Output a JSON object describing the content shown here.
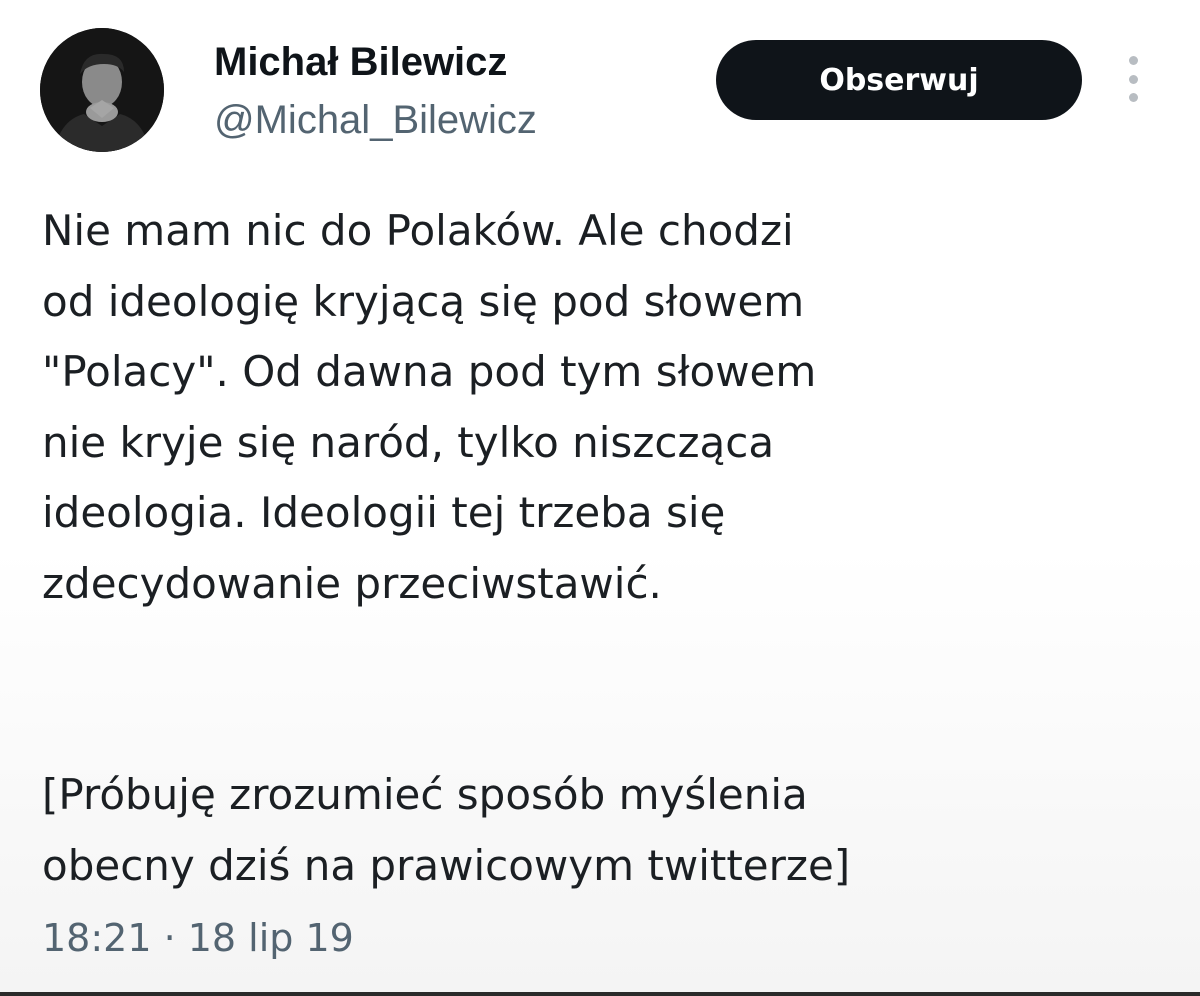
{
  "tweet": {
    "author": {
      "name": "Michał Bilewicz",
      "handle": "@Michal_Bilewicz"
    },
    "follow_label": "Obserwuj",
    "body": {
      "paragraph1": [
        "Nie mam nic do Polaków. Ale chodzi",
        "od ideologię kryjącą się pod słowem",
        "\"Polacy\". Od dawna pod tym słowem",
        "nie kryje się naród, tylko niszcząca",
        "ideologia. Ideologii tej trzeba się",
        "zdecydowanie przeciwstawić."
      ],
      "paragraph2": [
        "[Próbuję zrozumieć sposób myślenia",
        "obecny dziś na prawicowym twitterze]"
      ]
    },
    "timestamp": "18:21 · 18 lip 19"
  },
  "icons": {
    "more": "more-vertical-icon",
    "avatar": "user-photo"
  },
  "colors": {
    "text_primary": "#0f1419",
    "text_secondary": "#536471",
    "button_bg": "#0f1419",
    "button_text": "#ffffff",
    "more_dots": "#b8bdc2"
  }
}
